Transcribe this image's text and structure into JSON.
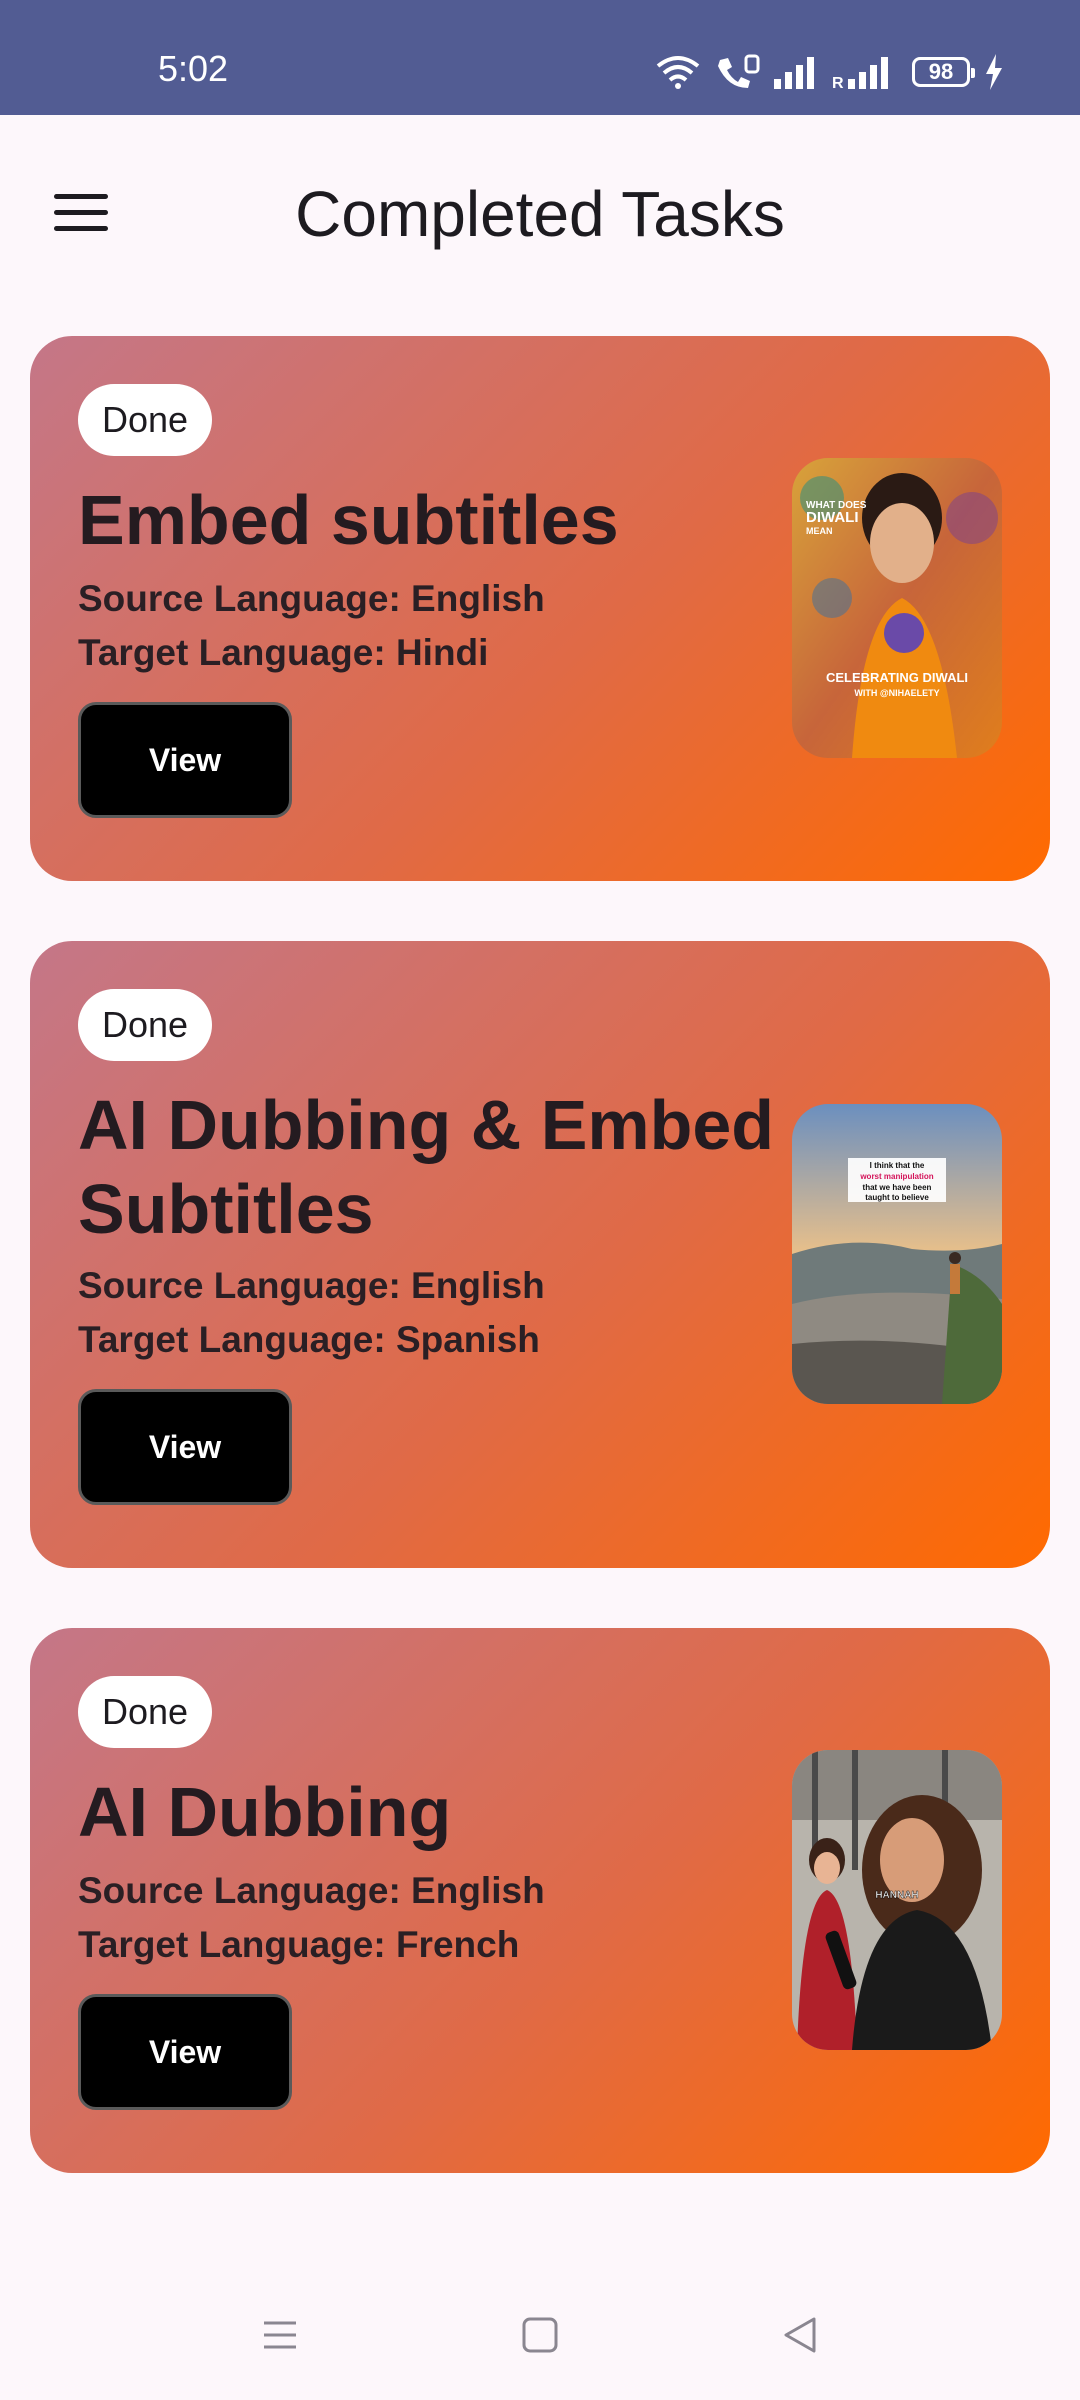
{
  "status_bar": {
    "time": "5:02",
    "battery": "98"
  },
  "app_bar": {
    "title": "Completed Tasks"
  },
  "tasks": [
    {
      "status": "Done",
      "title": "Embed subtitles",
      "source": "Source Language: English",
      "target": "Target Language: Hindi",
      "button": "View",
      "thumb_text": [
        "WHAT DOES",
        "DIWALI",
        "MEAN",
        "CELEBRATING DIWALI",
        "WITH @NIHAELETY"
      ]
    },
    {
      "status": "Done",
      "title": "AI Dubbing & Embed Subtitles",
      "source": "Source Language: English",
      "target": "Target Language: Spanish",
      "button": "View",
      "thumb_text": [
        "I think that the",
        "worst manipulation",
        "that we have been",
        "taught to believe"
      ]
    },
    {
      "status": "Done",
      "title": "AI Dubbing",
      "source": "Source Language: English",
      "target": "Target Language: French",
      "button": "View",
      "thumb_text": [
        "HANNAH"
      ]
    }
  ],
  "colors": {
    "status_bar": "#525c93",
    "card_gradient_start": "#c47788",
    "card_gradient_end": "#ff6a00",
    "button": "#000000"
  },
  "icons": [
    "hamburger-menu-icon",
    "wifi-icon",
    "call-icon",
    "signal-icon",
    "battery-icon",
    "charging-icon",
    "nav-recents-icon",
    "nav-home-icon",
    "nav-back-icon"
  ]
}
